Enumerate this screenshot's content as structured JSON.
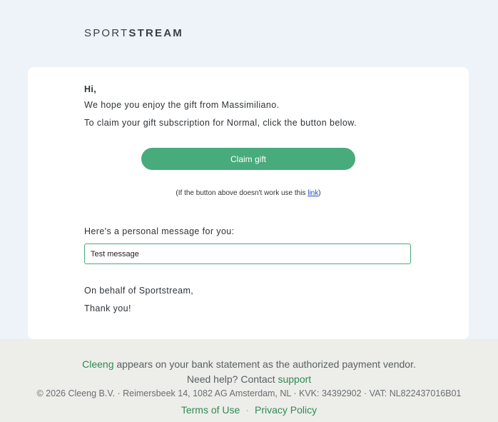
{
  "brand": {
    "light": "SPORT",
    "bold": "STREAM"
  },
  "email": {
    "greeting": "Hi,",
    "line1": "We hope you enjoy the gift from Massimiliano.",
    "line2": "To claim your gift subscription for Normal, click the button below.",
    "claim_button": "Claim gift",
    "fallback_prefix": "(If the button above doesn't work use this ",
    "fallback_link": "link",
    "fallback_suffix": ")",
    "personal_label": "Here's a personal message for you:",
    "personal_message": "Test message",
    "behalf": "On behalf of Sportstream,",
    "thanks": "Thank you!"
  },
  "footer": {
    "vendor_name": "Cleeng",
    "vendor_text": " appears on your bank statement as the authorized payment vendor.",
    "help_text": "Need help? Contact ",
    "help_link": "support",
    "legal": "© 2026 Cleeng B.V. · Reimersbeek 14, 1082 AG Amsterdam, NL · KVK: 34392902 · VAT: NL822437016B01",
    "terms": "Terms of Use",
    "separator": "·",
    "privacy": "Privacy Policy"
  },
  "colors": {
    "accent": "#47ab7c",
    "link": "#1d4fc4",
    "footer_green": "#2e8a55",
    "background": "#eef2f9"
  }
}
